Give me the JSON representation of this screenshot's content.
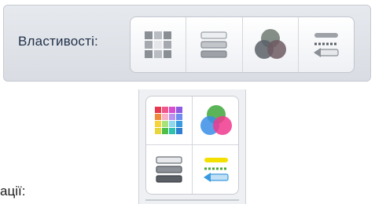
{
  "toolbar": {
    "properties_label": "Властивості:",
    "buttons": [
      {
        "icon": "grid-icon"
      },
      {
        "icon": "list-rows-icon"
      },
      {
        "icon": "color-circles-icon"
      },
      {
        "icon": "dashed-arrow-icon"
      }
    ]
  },
  "panel": {
    "buttons": [
      {
        "icon": "color-grid-icon"
      },
      {
        "icon": "color-circles-icon"
      },
      {
        "icon": "list-rows-icon"
      },
      {
        "icon": "dashed-arrow-icon"
      }
    ]
  },
  "background_text": "ації:",
  "colors": {
    "label_text": "#1f2f49",
    "toolbar_bg": "#dfe2e7",
    "gray_icon": "#8d9198",
    "yellow": "#f4e000",
    "green": "#3ea83b",
    "blue": "#3a9ae0",
    "pink": "#f0388e"
  }
}
